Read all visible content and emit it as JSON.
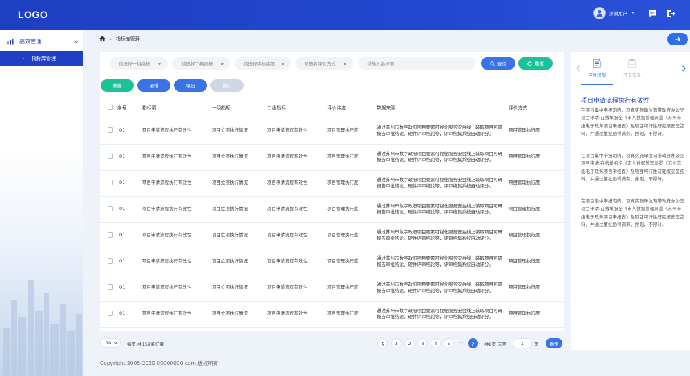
{
  "header": {
    "logo": "LOGO",
    "user_name": "测试用户",
    "icons": [
      "avatar-icon",
      "chat-icon",
      "logout-icon"
    ]
  },
  "sidebar": {
    "group_label": "绩效管理",
    "active_item": "指标库管理"
  },
  "breadcrumb": {
    "current": "指标库管理"
  },
  "filters": {
    "level1_placeholder": "请选择一级指标",
    "level2_placeholder": "请选择二级指标",
    "dimension_placeholder": "请选择评价纬度",
    "method_placeholder": "请选择评价方式",
    "search_placeholder": "请输入指标项",
    "query_label": "查询",
    "reset_label": "重置"
  },
  "toolbar": {
    "add_label": "新建",
    "edit_label": "编辑",
    "export_label": "导出",
    "delete_label": "删除"
  },
  "table": {
    "headers": {
      "index": "序号",
      "item": "指标项",
      "level1": "一级指标",
      "level2": "二级指标",
      "dimension": "评价纬度",
      "source": "数据来源",
      "method": "评价方式"
    },
    "rows": [
      {
        "index": "01",
        "item": "项目申请流程执行有效性",
        "level1": "项目立项执行情况",
        "level2": "项目申请流程有效性",
        "dimension": "项目管理执行度",
        "source": "通过苏州市数字政府项目要素可视化服务安台线上装取项目可研报告审批结论、硬件评审结论等，评审结集系统自动评分。",
        "method": "项目管理执行度"
      },
      {
        "index": "01",
        "item": "项目申请流程执行有效性",
        "level1": "项目立项执行情况",
        "level2": "项目申请流程有效性",
        "dimension": "项目管理执行度",
        "source": "通过苏州市数字政府项目要素可视化服务安台线上装取项目可研报告审批结论、硬件评审结论等，评审结集系统自动评分。",
        "method": "项目管理执行度"
      },
      {
        "index": "01",
        "item": "项目申请流程执行有效性",
        "level1": "项目立项执行情况",
        "level2": "项目申请流程有效性",
        "dimension": "项目管理执行度",
        "source": "通过苏州市数字政府项目要素可视化服务安台线上装取项目可研报告审批结论、硬件评审结论等，评审结集系统自动评分。",
        "method": "项目管理执行度"
      },
      {
        "index": "01",
        "item": "项目申请流程执行有效性",
        "level1": "项目立项执行情况",
        "level2": "项目申请流程有效性",
        "dimension": "项目管理执行度",
        "source": "通过苏州市数字政府项目要素可视化服务安台线上装取项目可研报告审批结论、硬件评审结论等，评审结集系统自动评分。",
        "method": "项目管理执行度"
      },
      {
        "index": "01",
        "item": "项目申请流程执行有效性",
        "level1": "项目立项执行情况",
        "level2": "项目申请流程有效性",
        "dimension": "项目管理执行度",
        "source": "通过苏州市数字政府项目要素可视化服务安台线上装取项目可研报告审批结论、硬件评审结论等，评审结集系统自动评分。",
        "method": "项目管理执行度"
      },
      {
        "index": "01",
        "item": "项目申请流程执行有效性",
        "level1": "项目立项执行情况",
        "level2": "项目申请流程有效性",
        "dimension": "项目管理执行度",
        "source": "通过苏州市数字政府项目要素可视化服务安台线上装取项目可研报告审批结论、硬件评审结论等，评审结集系统自动评分。",
        "method": "项目管理执行度"
      },
      {
        "index": "01",
        "item": "项目申请流程执行有效性",
        "level1": "项目立项执行情况",
        "level2": "项目申请流程有效性",
        "dimension": "项目管理执行度",
        "source": "通过苏州市数字政府项目要素可视化服务安台线上装取项目可研报告审批结论、硬件评审结论等，评审结集系统自动评分。",
        "method": "项目管理执行度"
      },
      {
        "index": "01",
        "item": "项目申请流程执行有效性",
        "level1": "项目立项执行情况",
        "level2": "项目申请流程有效性",
        "dimension": "项目管理执行度",
        "source": "通过苏州市数字政府项目要素可视化服务安台线上装取项目可研报告审批结论、硬件评审结论等，评审结集系统自动评分。",
        "method": "项目管理执行度"
      }
    ]
  },
  "pagination": {
    "page_size": "10",
    "records_text": "每页,共159条记录",
    "pages": [
      "1",
      "2",
      "3",
      "4",
      "5"
    ],
    "ellipsis": "···",
    "total_text": "共8页 去第",
    "goto_value": "1",
    "page_unit": "页",
    "confirm_label": "确定"
  },
  "footer": {
    "copyright": "Copyright 2005-2020 00000000.com 版权所有"
  },
  "rpanel": {
    "tab_rules": "评分规则",
    "tab_other": "其它信息",
    "title": "项目申请流程执行有效性",
    "paragraphs": [
      "在项目集中申报期内，项真实施单位向带政府办公交项目申请:在线填报全《市人数据管理局提《苏州市级电子政务项目申报表》及项目可行性研究报安医弦料，并通过董批励得满劳，舍则，不得分。",
      "在项目集中申报期内，项真实施单位向带政府办公交项目申请:在线填报全《市人数据管理局提《苏州市级电子政务项目申报表》及项目可行性研究报安医弦料，并通过董批励得满劳，舍则，不得分。",
      "在项目集中申报期内，项真实施单位向带政府办公交项目申请:在线填报全《市人数据管理局提《苏州市级电子政务项目申报表》及项目可行性研究报安医弦料，并通过董批励得满劳，舍则，不得分。"
    ]
  },
  "colors": {
    "header": "#1d3fc2",
    "primary": "#3a73e6",
    "success": "#19c397",
    "disabled": "#cfd6e4"
  }
}
